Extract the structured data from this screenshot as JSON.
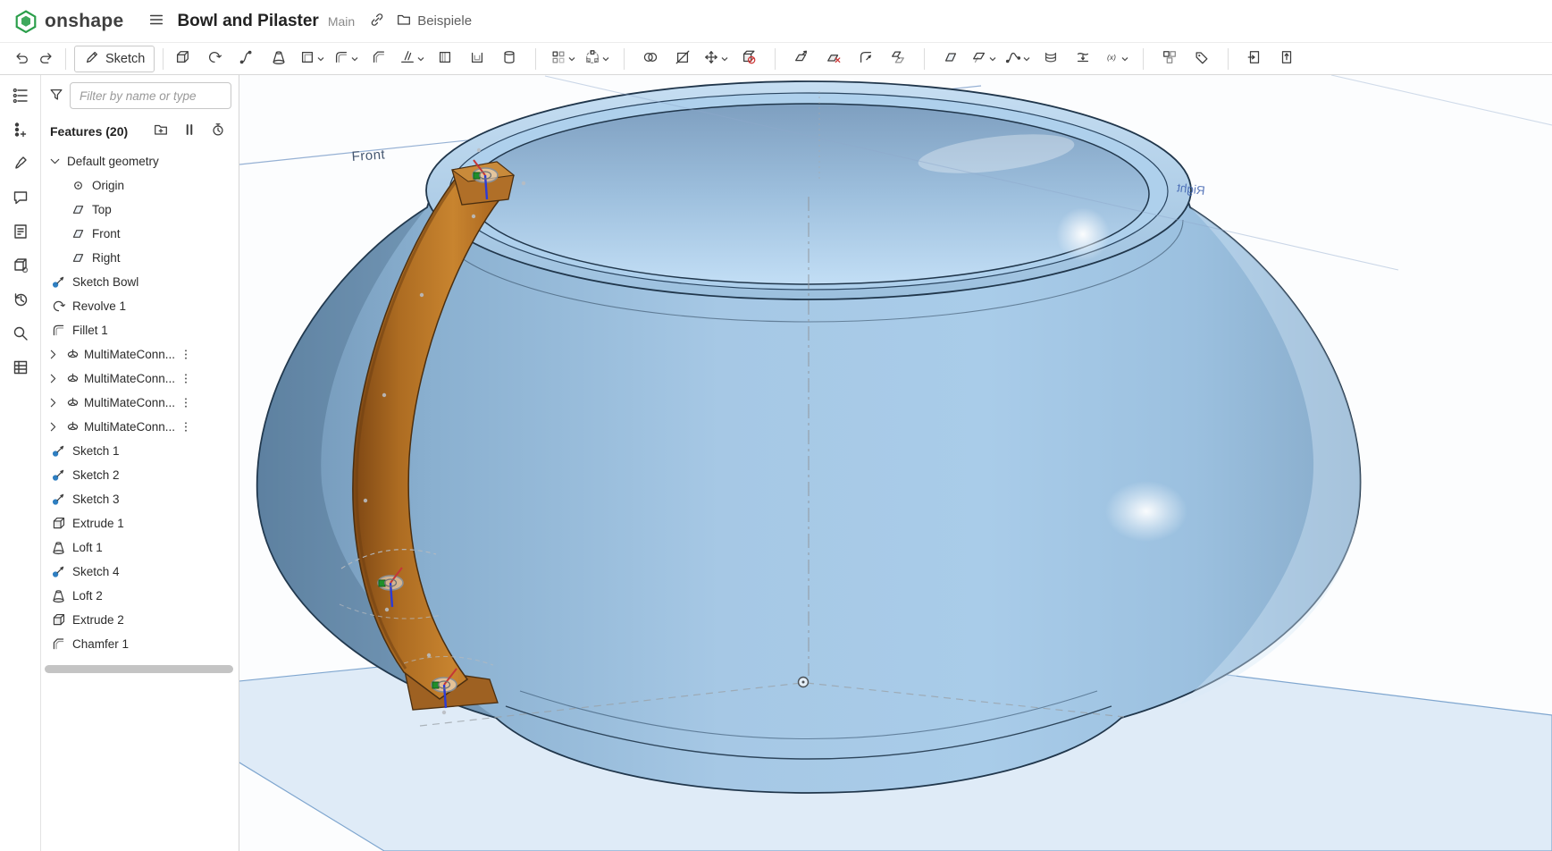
{
  "header": {
    "logo_text": "onshape",
    "document_title": "Bowl and Pilaster",
    "branch_label": "Main",
    "folder_label": "Beispiele"
  },
  "toolbar": {
    "sketch_label": "Sketch",
    "variable_label": "(x)",
    "groups": [
      [
        {
          "name": "extrude"
        },
        {
          "name": "revolve"
        },
        {
          "name": "sweep"
        },
        {
          "name": "loft"
        },
        {
          "name": "thicken",
          "chevron": true
        },
        {
          "name": "fillet",
          "chevron": true
        },
        {
          "name": "chamfer"
        },
        {
          "name": "draft",
          "chevron": true
        },
        {
          "name": "rib"
        },
        {
          "name": "shell"
        },
        {
          "name": "hole"
        }
      ],
      [
        {
          "name": "linear-pattern",
          "chevron": true
        },
        {
          "name": "circular-pattern",
          "chevron": true
        }
      ],
      [
        {
          "name": "boolean"
        },
        {
          "name": "split"
        },
        {
          "name": "transform",
          "chevron": true
        },
        {
          "name": "delete-part"
        }
      ],
      [
        {
          "name": "move-face"
        },
        {
          "name": "delete-face"
        },
        {
          "name": "modify-fillet"
        },
        {
          "name": "replace-face"
        }
      ],
      [
        {
          "name": "plane"
        },
        {
          "name": "offset-surface",
          "chevron": true
        },
        {
          "name": "composite-curve",
          "chevron": true
        },
        {
          "name": "helix"
        },
        {
          "name": "projected-curve"
        },
        {
          "name": "variable",
          "chevron": true
        }
      ],
      [
        {
          "name": "custom-features"
        },
        {
          "name": "tag"
        }
      ],
      [
        {
          "name": "import-doc"
        },
        {
          "name": "export-doc"
        }
      ]
    ]
  },
  "left_rail": {
    "icons": [
      "feature-list",
      "configurations",
      "appearance",
      "comments",
      "notes",
      "publications",
      "history",
      "search",
      "bom"
    ]
  },
  "feature_panel": {
    "filter_placeholder": "Filter by name or type",
    "features_header": "Features (20)",
    "tree": [
      {
        "label": "Default geometry",
        "icon": "group",
        "kind": "group"
      },
      {
        "label": "Origin",
        "icon": "origin",
        "kind": "child"
      },
      {
        "label": "Top",
        "icon": "plane",
        "kind": "child"
      },
      {
        "label": "Front",
        "icon": "plane",
        "kind": "child"
      },
      {
        "label": "Right",
        "icon": "plane",
        "kind": "child"
      },
      {
        "label": "Sketch Bowl",
        "icon": "sketch",
        "kind": "feature"
      },
      {
        "label": "Revolve 1",
        "icon": "revolve",
        "kind": "feature"
      },
      {
        "label": "Fillet 1",
        "icon": "fillet",
        "kind": "feature"
      },
      {
        "label": "MultiMateConn...",
        "icon": "mate",
        "kind": "expandable"
      },
      {
        "label": "MultiMateConn...",
        "icon": "mate",
        "kind": "expandable"
      },
      {
        "label": "MultiMateConn...",
        "icon": "mate",
        "kind": "expandable"
      },
      {
        "label": "MultiMateConn...",
        "icon": "mate",
        "kind": "expandable"
      },
      {
        "label": "Sketch 1",
        "icon": "sketch",
        "kind": "feature"
      },
      {
        "label": "Sketch 2",
        "icon": "sketch",
        "kind": "feature"
      },
      {
        "label": "Sketch 3",
        "icon": "sketch",
        "kind": "feature"
      },
      {
        "label": "Extrude 1",
        "icon": "extrude",
        "kind": "feature"
      },
      {
        "label": "Loft 1",
        "icon": "loft",
        "kind": "feature"
      },
      {
        "label": "Sketch 4",
        "icon": "sketch",
        "kind": "feature"
      },
      {
        "label": "Loft 2",
        "icon": "loft",
        "kind": "feature"
      },
      {
        "label": "Extrude 2",
        "icon": "extrude",
        "kind": "feature"
      },
      {
        "label": "Chamfer 1",
        "icon": "chamfer",
        "kind": "feature"
      }
    ]
  },
  "viewport": {
    "front_label": "Front",
    "right_label": "Right",
    "colors": {
      "bowl": "#a6c8e5",
      "handle": "#c8842f",
      "plane": "#c2d9ef",
      "logo_green": "#2a9e4a"
    }
  }
}
